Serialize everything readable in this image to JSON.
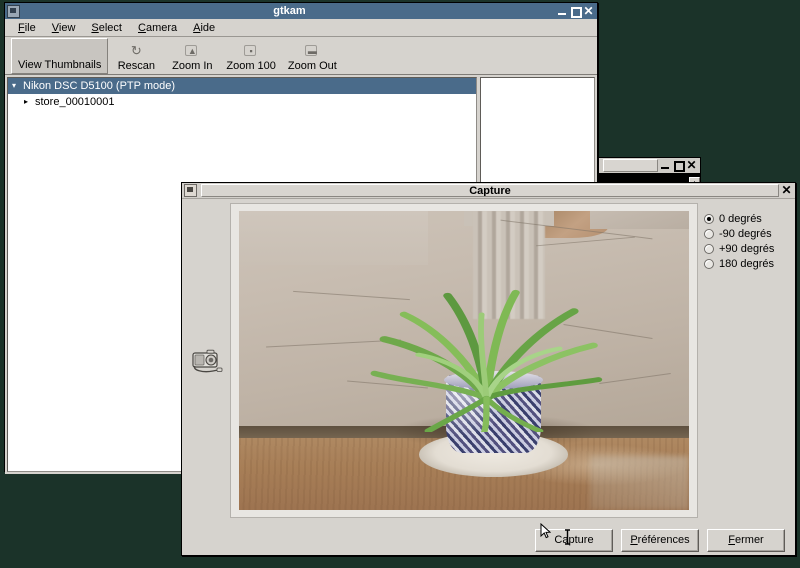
{
  "desktop": {
    "background_color": "#1b3329"
  },
  "main_window": {
    "title": "gtkam",
    "titlebar_color": "#4a6b8a",
    "icon": "camera-app-icon",
    "window_buttons": {
      "minimize": "minimize-icon",
      "maximize": "maximize-icon",
      "close": "close-icon"
    },
    "menu": [
      {
        "label": "File",
        "accel": "F"
      },
      {
        "label": "View",
        "accel": "V"
      },
      {
        "label": "Select",
        "accel": "S"
      },
      {
        "label": "Camera",
        "accel": "C"
      },
      {
        "label": "Aide",
        "accel": "A"
      }
    ],
    "toolbar": [
      {
        "label": "View Thumbnails",
        "icon": "thumbnails-icon",
        "pressed": true
      },
      {
        "label": "Rescan",
        "icon": "refresh-icon",
        "pressed": false
      },
      {
        "label": "Zoom In",
        "icon": "zoom-in-icon",
        "pressed": false
      },
      {
        "label": "Zoom 100",
        "icon": "zoom-100-icon",
        "pressed": false
      },
      {
        "label": "Zoom Out",
        "icon": "zoom-out-icon",
        "pressed": false
      }
    ],
    "tree": [
      {
        "label": "Nikon DSC D5100 (PTP mode)",
        "expanded": true,
        "selected": true,
        "level": 0
      },
      {
        "label": "store_00010001",
        "expanded": false,
        "selected": false,
        "level": 1
      }
    ]
  },
  "background_window": {
    "title": "",
    "window_buttons": {
      "minimize": "minimize-icon",
      "maximize": "maximize-icon",
      "close": "close-icon"
    },
    "scroll_arrow": "▲"
  },
  "capture_dialog": {
    "title": "Capture",
    "icon": "camera-app-icon",
    "close_button": "close-icon",
    "preview_icon": "camera-device-icon",
    "rotation_options": [
      {
        "label": "0 degrés",
        "selected": true
      },
      {
        "label": "-90 degrés",
        "selected": false
      },
      {
        "label": "+90 degrés",
        "selected": false
      },
      {
        "label": "180 degrés",
        "selected": false
      }
    ],
    "buttons": [
      {
        "label": "Capture",
        "accel": ""
      },
      {
        "label": "Préférences",
        "accel": "P"
      },
      {
        "label": "Fermer",
        "accel": "F"
      }
    ],
    "photo": {
      "description": "Spider plant in a blue-and-white porcelain pot on a saucer, on a wooden floor in front of a cracked plaster wall with a radiator"
    },
    "cursor": {
      "arrow": "pointer-cursor",
      "text": "text-cursor"
    }
  }
}
